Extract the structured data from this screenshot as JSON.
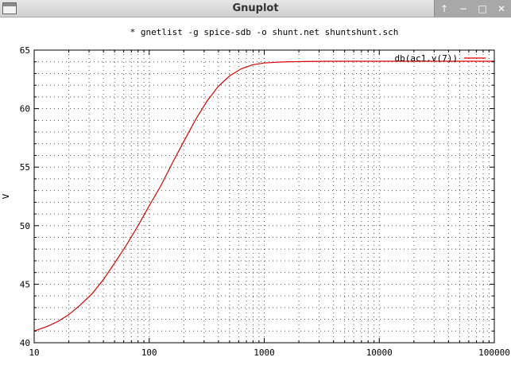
{
  "window": {
    "title": "Gnuplot",
    "controls": [
      {
        "name": "up-icon",
        "glyph": "↑"
      },
      {
        "name": "minimize-icon",
        "glyph": "−"
      },
      {
        "name": "maximize-icon",
        "glyph": "□"
      },
      {
        "name": "close-icon",
        "glyph": "✕"
      }
    ]
  },
  "colors": {
    "curve": "#e00000",
    "axis": "#000000",
    "grid": "#555555"
  },
  "chart_data": {
    "type": "line",
    "title": "* gnetlist -g spice-sdb -o shunt.net shuntshunt.sch",
    "xlabel": "",
    "ylabel": "V",
    "xscale": "log",
    "xlim": [
      10,
      100000
    ],
    "ylim": [
      40,
      65
    ],
    "xticks": [
      10,
      100,
      1000,
      10000,
      100000
    ],
    "xtick_labels": [
      "10",
      "100",
      "1000",
      "10000",
      "100000"
    ],
    "yticks": [
      40,
      45,
      50,
      55,
      60,
      65
    ],
    "ytick_labels": [
      "40",
      "45",
      "50",
      "55",
      "60",
      "65"
    ],
    "grid": true,
    "legend_position": "top-right",
    "series": [
      {
        "name": "db(ac1.v(7))",
        "x": [
          10,
          13,
          16,
          20,
          25,
          32,
          40,
          50,
          63,
          80,
          100,
          126,
          158,
          200,
          251,
          316,
          398,
          501,
          631,
          794,
          1000,
          1259,
          1585,
          2000,
          2512,
          3162,
          5000,
          10000,
          100000
        ],
        "y": [
          41.0,
          41.4,
          41.8,
          42.4,
          43.2,
          44.2,
          45.4,
          46.8,
          48.3,
          50.0,
          51.7,
          53.4,
          55.3,
          57.2,
          59.0,
          60.6,
          61.9,
          62.8,
          63.4,
          63.75,
          63.9,
          63.96,
          64.0,
          64.02,
          64.03,
          64.04,
          64.05,
          64.05,
          64.05
        ]
      }
    ]
  }
}
